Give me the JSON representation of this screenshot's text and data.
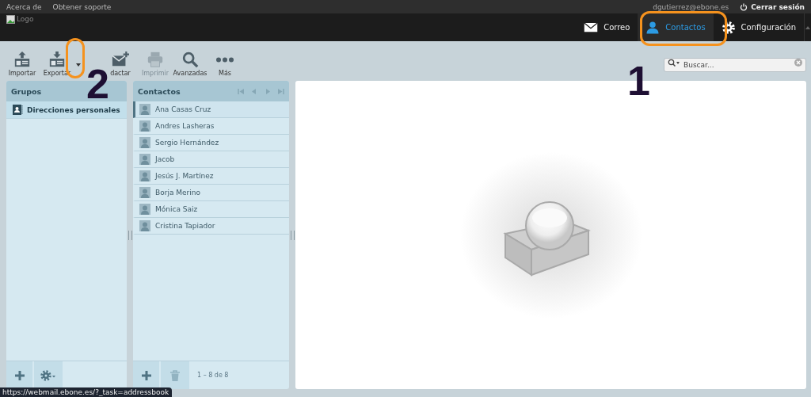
{
  "top_bar": {
    "links": [
      "Acerca de",
      "Obtener soporte"
    ],
    "user": "dgutierrez@ebone.es",
    "logout": "Cerrar sesión"
  },
  "header": {
    "logo_alt": "Logo",
    "nav": [
      {
        "label": "Correo",
        "selected": false
      },
      {
        "label": "Contactos",
        "selected": true
      },
      {
        "label": "Configuración",
        "selected": false
      }
    ]
  },
  "toolbar": {
    "buttons": [
      {
        "label": "Importar",
        "disabled": false,
        "dropdown": false
      },
      {
        "label": "Exportar",
        "disabled": false,
        "dropdown": true
      },
      {
        "label": "dactar",
        "disabled": false,
        "dropdown": false
      },
      {
        "label": "Imprimir",
        "disabled": true,
        "dropdown": false
      },
      {
        "label": "Avanzadas",
        "disabled": false,
        "dropdown": false
      },
      {
        "label": "Más",
        "disabled": false,
        "dropdown": false
      }
    ]
  },
  "search": {
    "placeholder": "Buscar..."
  },
  "groups_panel": {
    "title": "Grupos",
    "items": [
      {
        "label": "Direcciones personales",
        "selected": true
      }
    ]
  },
  "contacts_panel": {
    "title": "Contactos",
    "count": "1 – 8 de 8",
    "items": [
      {
        "name": "Ana Casas Cruz",
        "focused": true
      },
      {
        "name": "Andres Lasheras",
        "focused": false
      },
      {
        "name": "Sergio Hernández",
        "focused": false
      },
      {
        "name": "Jacob",
        "focused": false
      },
      {
        "name": "Jesús J. Martínez",
        "focused": false
      },
      {
        "name": "Borja Merino",
        "focused": false
      },
      {
        "name": "Mónica Saiz",
        "focused": false
      },
      {
        "name": "Cristina Tapiador",
        "focused": false
      }
    ]
  },
  "status_url": "https://webmail.ebone.es/?_task=addressbook",
  "annotations": [
    {
      "kind": "highlight"
    },
    {
      "kind": "number",
      "label": "2"
    },
    {
      "kind": "highlight"
    },
    {
      "kind": "number",
      "label": "1"
    }
  ]
}
